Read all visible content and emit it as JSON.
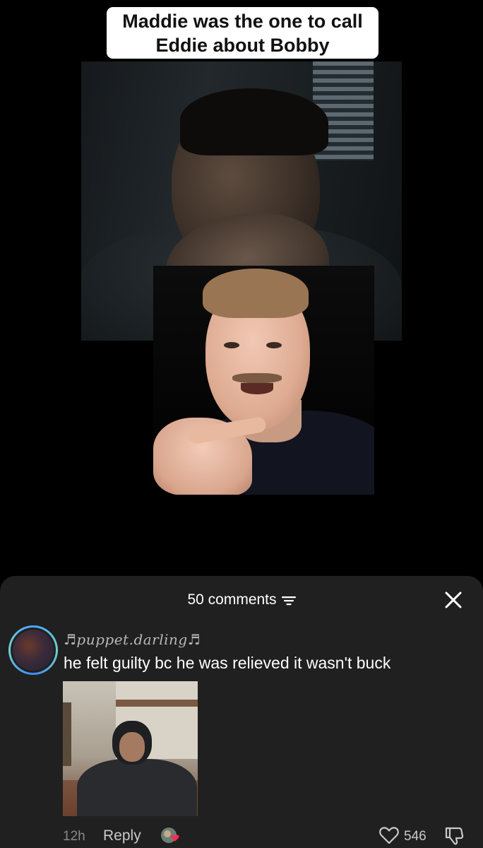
{
  "video": {
    "caption": "Maddie was the one to call Eddie about Bobby"
  },
  "comments_sheet": {
    "count_label": "50 comments",
    "filter_icon": "sort-filter-icon",
    "close_icon": "close-icon",
    "comment": {
      "username": "♬puppet.darling♬",
      "text": "he felt guilty bc he was relieved it wasn't buck",
      "time": "12h",
      "reply_label": "Reply",
      "like_count": "546",
      "has_creator_like": true,
      "has_image_attachment": true
    }
  },
  "colors": {
    "sheet_bg": "#202020",
    "avatar_ring": "#4aa3ff",
    "creator_heart": "#ff2d55"
  }
}
